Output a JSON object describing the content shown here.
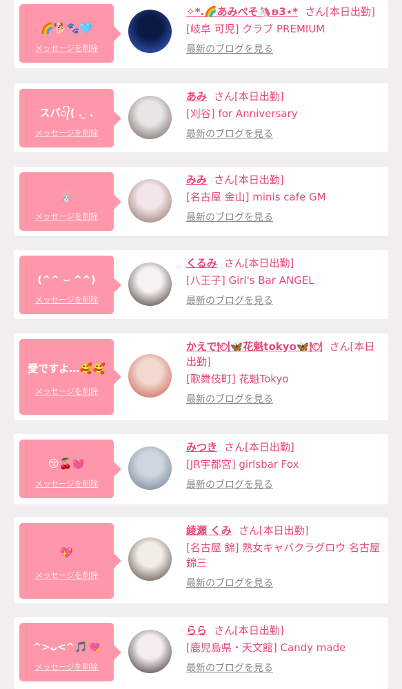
{
  "delete_label": "メッセージを削除",
  "san_suffix": "さん[本日出勤]",
  "blog_link": "最新のブログを見る",
  "colors": {
    "accent": "#e84776",
    "bubble": "#ff97ab",
    "card": "#ffffff",
    "page_bg": "#f0eeee",
    "link_gray": "#8a8a8a"
  },
  "entries": [
    {
      "message": "🌈🐕🐾🩵",
      "name": "✧*.🌈あみぺそ🦄ʚ3⋆*",
      "shop": "[岐阜 可児] クラブ PREMIUM",
      "avatar": "avatar-photo"
    },
    {
      "message": "スパ᭄( . ̫ .",
      "name": "あみ",
      "shop": "[刈谷] for Anniversary",
      "avatar": "avatar-photo"
    },
    {
      "message": "🐰",
      "name": "みみ",
      "shop": "[名古屋 金山] minis cafe GM",
      "avatar": "avatar-photo"
    },
    {
      "message": "(^^ ⌣ ^^)",
      "name": "くるみ",
      "shop": "[八王子] Girl's Bar ANGEL",
      "avatar": "avatar-photo"
    },
    {
      "message": "愛ですよ…🥰🥰",
      "name": "かえで🍽🦋花魁tokyo🦋🍽",
      "shop": "[歌舞伎町] 花魁Tokyo",
      "avatar": "avatar-photo"
    },
    {
      "message": "😚🍒💓",
      "name": "みつき",
      "shop": "[JR宇都宮] girlsbar Fox",
      "avatar": "avatar-photo"
    },
    {
      "message": "💖",
      "name": "綾瀬 くみ",
      "shop": "[名古屋 錦] 熟女キャバクラグロウ 名古屋錦三",
      "avatar": "avatar-photo"
    },
    {
      "message": "^>ᴗ<^🎵💘",
      "name": "らら",
      "shop": "[鹿児島県・天文館] Candy made",
      "avatar": "avatar-photo"
    }
  ]
}
